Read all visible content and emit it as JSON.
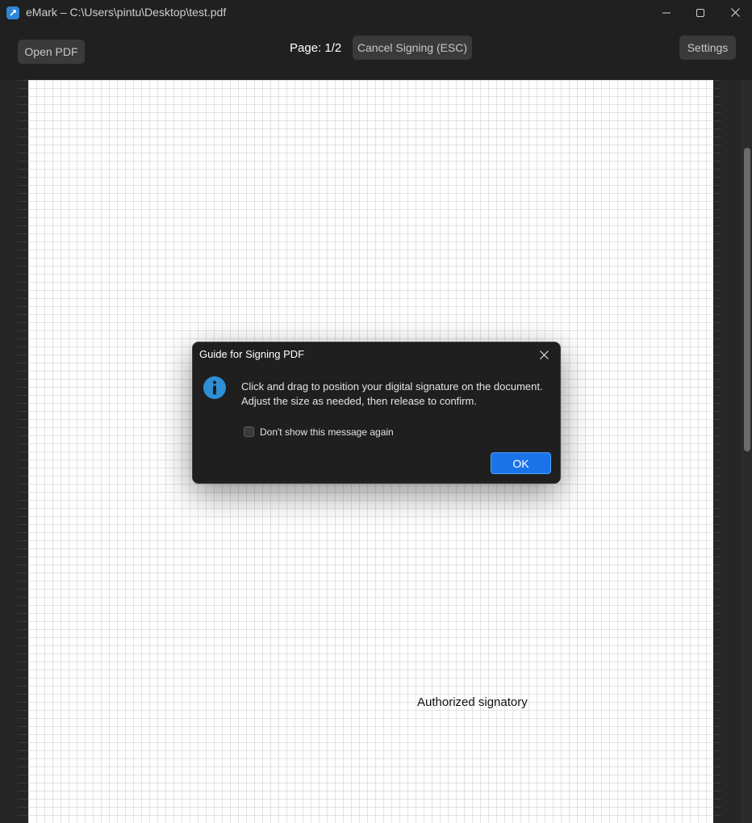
{
  "window": {
    "title": "eMark – C:\\Users\\pintu\\Desktop\\test.pdf"
  },
  "toolbar": {
    "open_label": "Open PDF",
    "page_label": "Page: 1/2",
    "cancel_label": "Cancel Signing (ESC)",
    "settings_label": "Settings"
  },
  "document": {
    "signatory_text": "Authorized signatory"
  },
  "dialog": {
    "title": "Guide for Signing PDF",
    "message_line1": "Click and drag to position your digital signature on the document.",
    "message_line2": "Adjust the size as needed, then release to confirm.",
    "checkbox_label": "Don't show this message again",
    "checkbox_checked": false,
    "ok_label": "OK"
  },
  "icons": {
    "app": "app-logo-icon",
    "minimize": "minimize-icon",
    "maximize": "maximize-icon",
    "close": "close-icon",
    "info": "info-icon",
    "dialog_close": "close-icon"
  },
  "colors": {
    "accent": "#1a73e8",
    "info": "#2f8fd6",
    "background": "#202020"
  }
}
